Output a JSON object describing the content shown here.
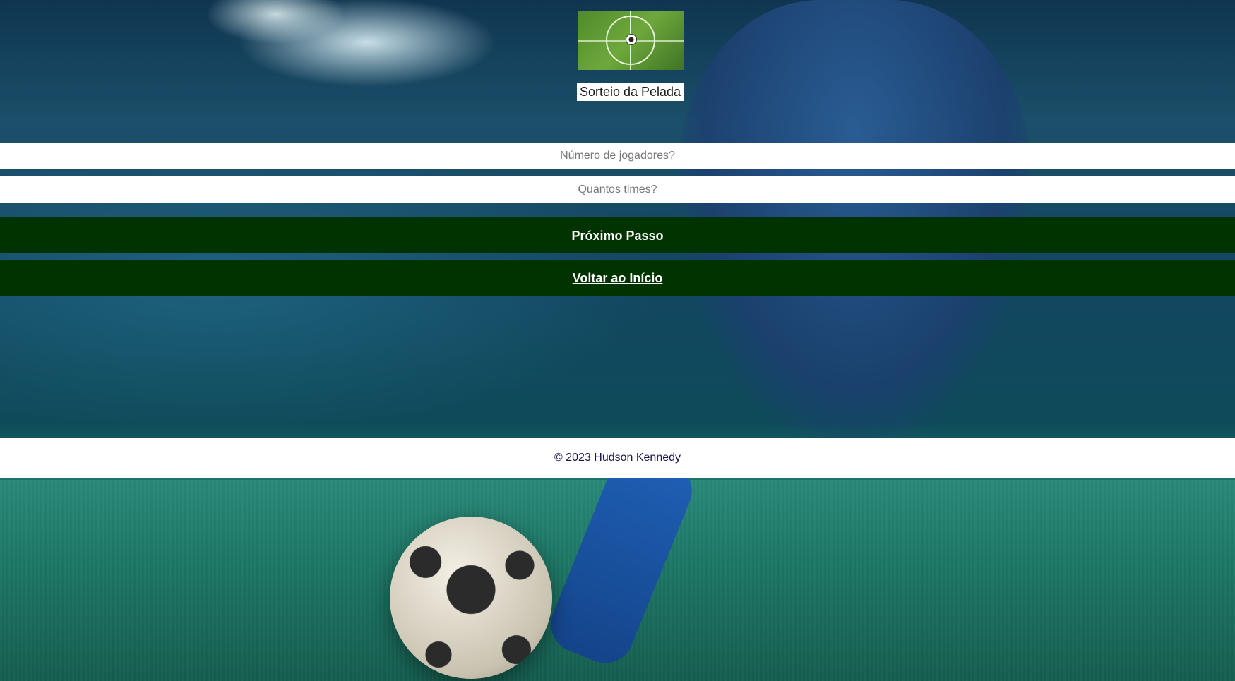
{
  "header": {
    "logo_icon": "soccer-field-icon",
    "title": "Sorteio da Pelada"
  },
  "form": {
    "players_placeholder": "Número de jogadores?",
    "teams_placeholder": "Quantos times?",
    "next_label": "Próximo Passo",
    "back_label": "Voltar ao Início"
  },
  "footer": {
    "copyright": "© 2023 Hudson Kennedy"
  },
  "colors": {
    "button_bg": "#003300",
    "button_text": "#ffffff"
  }
}
